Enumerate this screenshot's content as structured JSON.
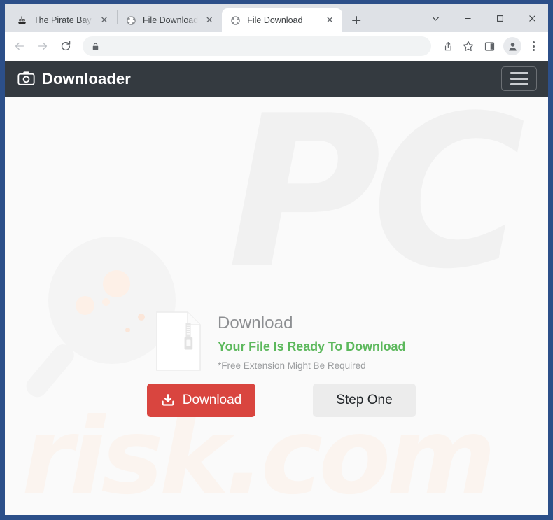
{
  "browser": {
    "tabs": [
      {
        "title": "The Pirate Bay - The",
        "favicon": "pirate-ship-icon",
        "active": false,
        "close_label": "✕"
      },
      {
        "title": "File Download",
        "favicon": "globe-icon",
        "active": false,
        "close_label": "✕"
      },
      {
        "title": "File Download",
        "favicon": "globe-icon",
        "active": true,
        "close_label": "✕"
      }
    ],
    "new_tab_label": "+",
    "window_controls": {
      "tab_search": "tab-search-chevron-icon",
      "minimize": "minimize-icon",
      "maximize": "maximize-icon",
      "close": "close-icon"
    },
    "toolbar": {
      "back": "back-arrow-icon",
      "forward": "forward-arrow-icon",
      "reload": "reload-icon",
      "lock": "lock-icon",
      "url": "",
      "url_placeholder": "",
      "share": "share-icon",
      "bookmark": "star-icon",
      "side_panel": "side-panel-icon",
      "profile": "profile-avatar-icon",
      "menu": "three-dot-menu-icon"
    }
  },
  "site": {
    "brand": {
      "icon": "camera-icon",
      "name": "Downloader"
    },
    "navbar_toggle": "hamburger-menu-icon",
    "card": {
      "file_icon": "zip-file-icon",
      "title": "Download",
      "ready_text": "Your File Is Ready To Download",
      "note": "*Free Extension Might Be Required"
    },
    "buttons": {
      "download": {
        "label": "Download",
        "icon": "download-tray-icon"
      },
      "step_one": {
        "label": "Step One"
      }
    },
    "watermarks": {
      "logo_text": "PC",
      "domain_text": "risk.com",
      "magnifier": "magnifying-glass-watermark"
    }
  },
  "colors": {
    "window_frame": "#2c4f89",
    "navbar_bg": "#343a40",
    "download_red": "#d9453f",
    "ready_green": "#5cb85c",
    "step_grey": "#ececec",
    "page_bg": "#fafafa"
  }
}
